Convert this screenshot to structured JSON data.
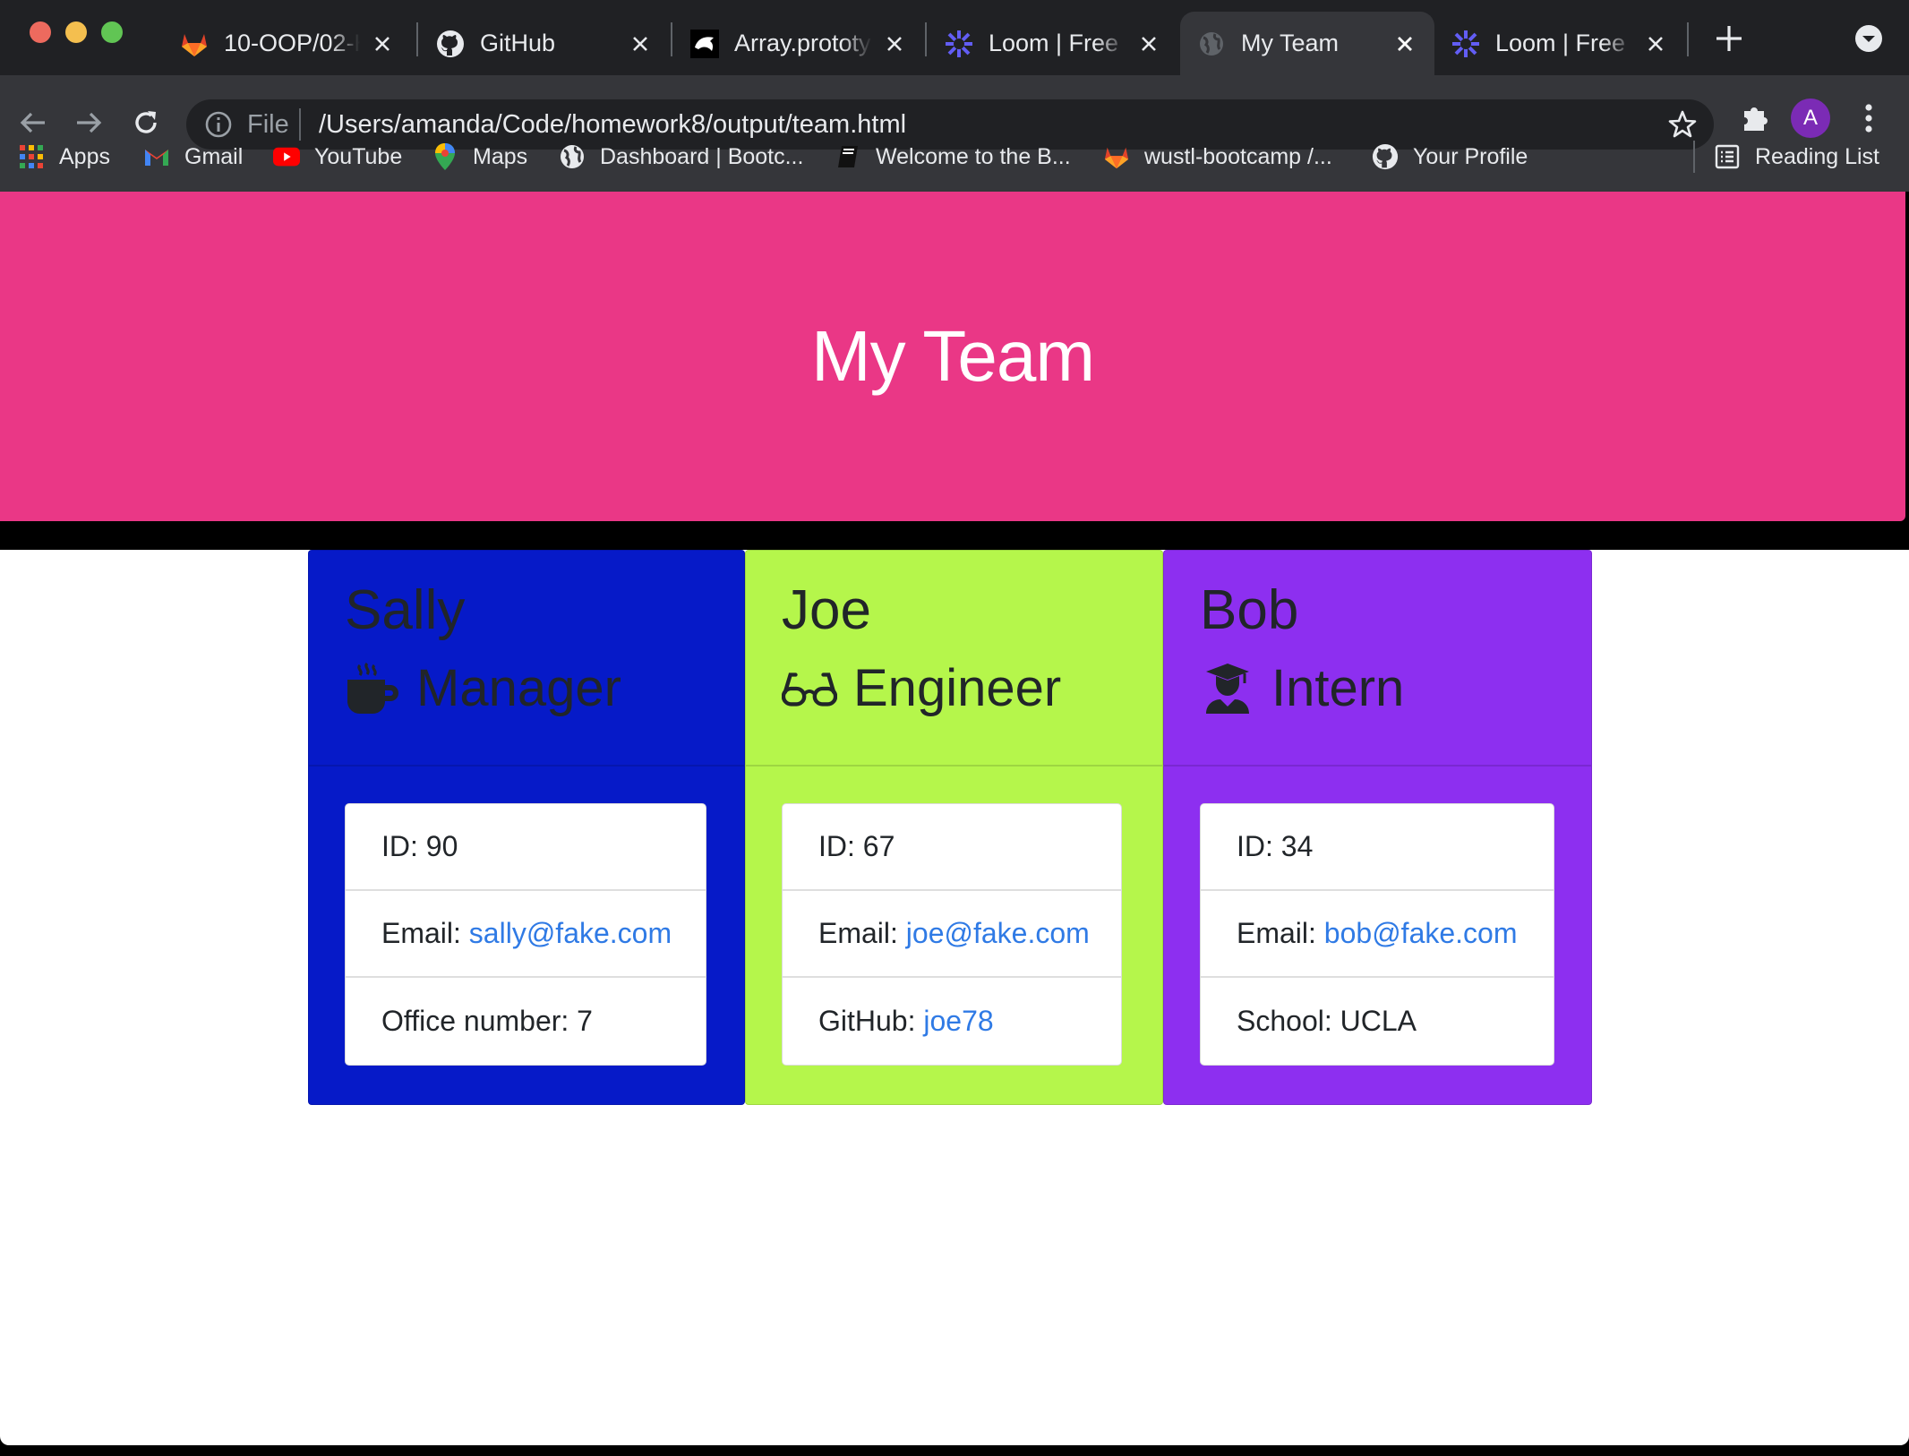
{
  "browser": {
    "tabs": [
      {
        "label": "10-OOP/02-Homework",
        "icon": "gitlab-icon"
      },
      {
        "label": "GitHub",
        "icon": "github-icon"
      },
      {
        "label": "Array.prototype",
        "icon": "mdn-icon"
      },
      {
        "label": "Loom | Free Screen",
        "icon": "loom-icon"
      },
      {
        "label": "My Team",
        "icon": "globe-icon"
      },
      {
        "label": "Loom | Free Screen",
        "icon": "loom-icon"
      }
    ],
    "address": {
      "scheme_label": "File",
      "url": "/Users/amanda/Code/homework8/output/team.html"
    },
    "profile_initial": "A",
    "bookmarks": [
      {
        "label": "Apps",
        "icon": "apps-grid-icon"
      },
      {
        "label": "Gmail",
        "icon": "gmail-icon"
      },
      {
        "label": "YouTube",
        "icon": "youtube-icon"
      },
      {
        "label": "Maps",
        "icon": "maps-pin-icon"
      },
      {
        "label": "Dashboard | Bootc...",
        "icon": "globe-icon"
      },
      {
        "label": "Welcome to the B...",
        "icon": "book-icon"
      },
      {
        "label": "wustl-bootcamp /...",
        "icon": "gitlab-icon"
      },
      {
        "label": "Your Profile",
        "icon": "github-icon"
      }
    ],
    "reading_list": "Reading List"
  },
  "page": {
    "title": "My Team",
    "colors": {
      "jumbotron": "#ea3786",
      "manager": "#061ac8",
      "engineer": "#b5f64b",
      "intern": "#8d2ff0",
      "link": "#2f7ae5"
    },
    "members": [
      {
        "name": "Sally",
        "role": "Manager",
        "role_icon": "coffee-mug-icon",
        "id_line": "ID: 90",
        "email_prefix": "Email:",
        "email": "sally@fake.com",
        "extra_prefix": "Office number: 7",
        "extra_value": ""
      },
      {
        "name": "Joe",
        "role": "Engineer",
        "role_icon": "glasses-icon",
        "id_line": "ID: 67",
        "email_prefix": "Email:",
        "email": "joe@fake.com",
        "extra_prefix": "GitHub:",
        "extra_value": "joe78"
      },
      {
        "name": "Bob",
        "role": "Intern",
        "role_icon": "graduate-icon",
        "id_line": "ID: 34",
        "email_prefix": "Email:",
        "email": "bob@fake.com",
        "extra_prefix": "School: UCLA",
        "extra_value": ""
      }
    ]
  }
}
